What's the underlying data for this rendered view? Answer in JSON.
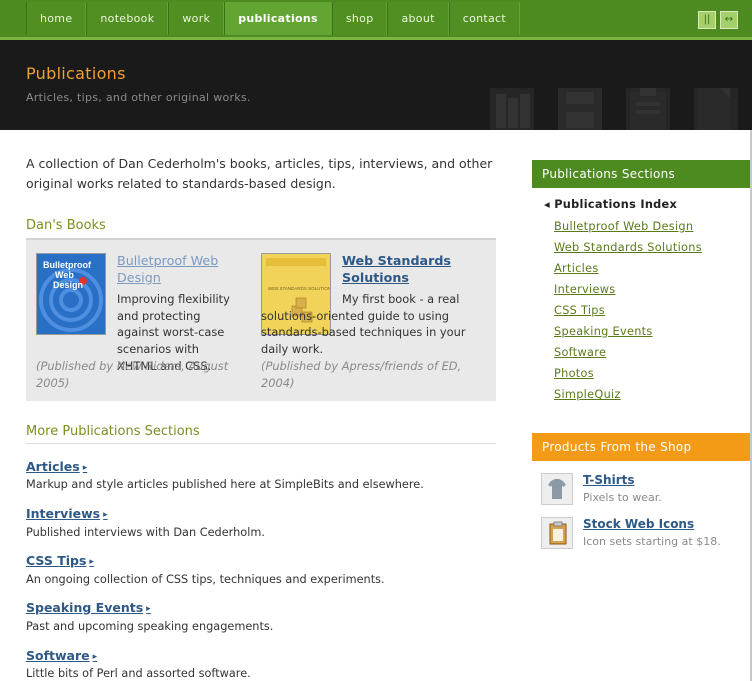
{
  "nav": {
    "items": [
      {
        "label": "home",
        "active": false
      },
      {
        "label": "notebook",
        "active": false
      },
      {
        "label": "work",
        "active": false
      },
      {
        "label": "publications",
        "active": true
      },
      {
        "label": "shop",
        "active": false
      },
      {
        "label": "about",
        "active": false
      },
      {
        "label": "contact",
        "active": false
      }
    ],
    "toggles": [
      {
        "icon": "narrow-layout-icon",
        "glyph": "||"
      },
      {
        "icon": "wide-layout-icon",
        "glyph": "↔"
      }
    ],
    "colors": {
      "bar": "#4d8a1f",
      "active": "#62a532"
    }
  },
  "header": {
    "title": "Publications",
    "subtitle": "Articles, tips, and other original works.",
    "title_color": "#f0a02f"
  },
  "main": {
    "intro": "A collection of Dan Cederholm's books, articles, tips, interviews, and other original works related to standards-based design.",
    "books_heading": "Dan's Books",
    "books": [
      {
        "title": "Bulletproof Web Design",
        "desc": "Improving flexibility and protecting against worst-case scenarios with XHTML and CSS.",
        "meta": "(Published by New Riders, August 2005)",
        "cover_title": "Bulletproof Web Design"
      },
      {
        "title": "Web Standards Solutions",
        "desc": "My first book - a real solutions-oriented guide to using standards-based techniques in your daily work.",
        "meta": "(Published by Apress/friends of ED, 2004)",
        "cover_title": "WEB STANDARDS SOLUTIONS"
      }
    ],
    "more_heading": "More Publications Sections",
    "sections": [
      {
        "title": "Articles",
        "desc": "Markup and style articles published here at SimpleBits and elsewhere."
      },
      {
        "title": "Interviews",
        "desc": "Published interviews with Dan Cederholm."
      },
      {
        "title": "CSS Tips",
        "desc": "An ongoing collection of CSS tips, techniques and experiments."
      },
      {
        "title": "Speaking Events",
        "desc": "Past and upcoming speaking engagements."
      },
      {
        "title": "Software",
        "desc": "Little bits of Perl and assorted software."
      }
    ]
  },
  "sidebar": {
    "sections_heading": "Publications Sections",
    "links": [
      {
        "label": "Publications Index",
        "current": true
      },
      {
        "label": "Bulletproof Web Design"
      },
      {
        "label": "Web Standards Solutions"
      },
      {
        "label": "Articles"
      },
      {
        "label": "Interviews"
      },
      {
        "label": "CSS Tips"
      },
      {
        "label": "Speaking Events"
      },
      {
        "label": "Software"
      },
      {
        "label": "Photos"
      },
      {
        "label": "SimpleQuiz"
      }
    ],
    "shop_heading": "Products From the Shop",
    "products": [
      {
        "title": "T-Shirts",
        "sub": "Pixels to wear.",
        "icon": "tshirt-icon"
      },
      {
        "title": "Stock Web Icons",
        "sub": "Icon sets starting at $18.",
        "icon": "clipboard-icon"
      }
    ]
  }
}
